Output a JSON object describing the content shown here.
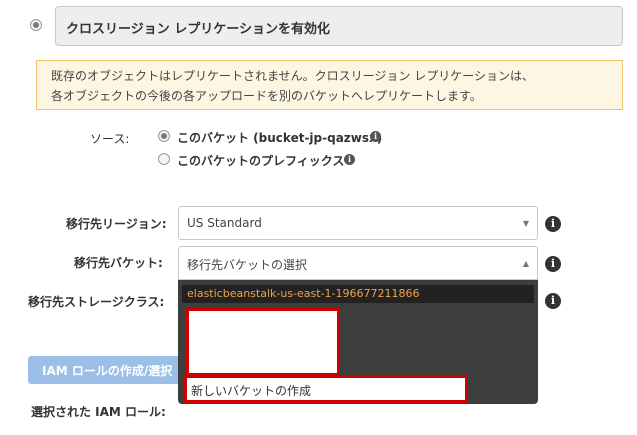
{
  "enable_replication": {
    "label": "クロスリージョン レプリケーションを有効化"
  },
  "notice": {
    "line1": "既存のオブジェクトはレプリケートされません。クロスリージョン レプリケーションは、",
    "line2": "各オブジェクトの今後の各アップロードを別のバケットへレプリケートします。"
  },
  "source": {
    "label": "ソース:",
    "options": [
      {
        "label": "このバケット (bucket-jp-qazwsx)",
        "selected": true
      },
      {
        "label": "このバケットのプレフィックス",
        "selected": false
      }
    ]
  },
  "destination_region": {
    "label": "移行先リージョン:",
    "value": "US Standard"
  },
  "destination_bucket": {
    "label": "移行先バケット:",
    "placeholder": "移行先バケットの選択",
    "options": [
      "elasticbeanstalk-us-east-1-196677211866",
      "新しいバケットの作成"
    ]
  },
  "storage_class": {
    "label": "移行先ストレージクラス:"
  },
  "iam": {
    "button_label": "IAM ロールの作成/選択",
    "selected_label": "選択された IAM ロール:"
  },
  "colors": {
    "notice_bg": "#fdf6e3",
    "notice_border": "#f0c36d",
    "dropdown_bg": "#3d3d3d",
    "dropdown_highlight_text": "#f0a34a",
    "highlight_border": "#d00000",
    "iam_button_bg": "#9bbfe6"
  }
}
